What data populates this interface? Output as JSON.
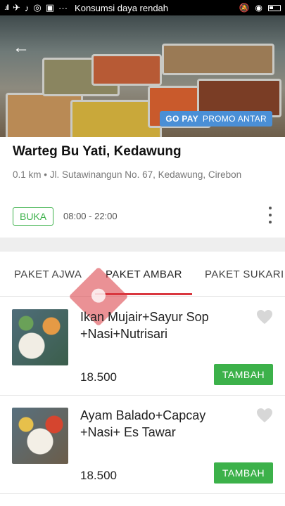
{
  "status_bar": {
    "notice": "Konsumsi daya rendah",
    "signal": ".ıll",
    "ellipsis": "···"
  },
  "hero": {
    "promo_gopay": "GO PAY",
    "promo_text": "PROMO ANTAR"
  },
  "restaurant": {
    "name": "Warteg Bu Yati, Kedawung",
    "address": "0.1 km • Jl. Sutawinangun No. 67, Kedawung, Cirebon",
    "status": "BUKA",
    "hours": "08:00 - 22:00"
  },
  "tabs": [
    {
      "label": "PAKET AJWA"
    },
    {
      "label": "PAKET AMBAR"
    },
    {
      "label": "PAKET SUKARI"
    }
  ],
  "menu": [
    {
      "title": "Ikan Mujair+Sayur Sop +Nasi+Nutrisari",
      "price": "18.500",
      "button": "TAMBAH"
    },
    {
      "title": "Ayam Balado+Capcay +Nasi+ Es Tawar",
      "price": "18.500",
      "button": "TAMBAH"
    }
  ],
  "colors": {
    "accent_green": "#3cb14a",
    "tab_underline": "#d9363e",
    "promo_blue": "#4a8fd6"
  },
  "icons": [
    "back-arrow-icon",
    "heart-icon",
    "more-vertical-icon"
  ]
}
